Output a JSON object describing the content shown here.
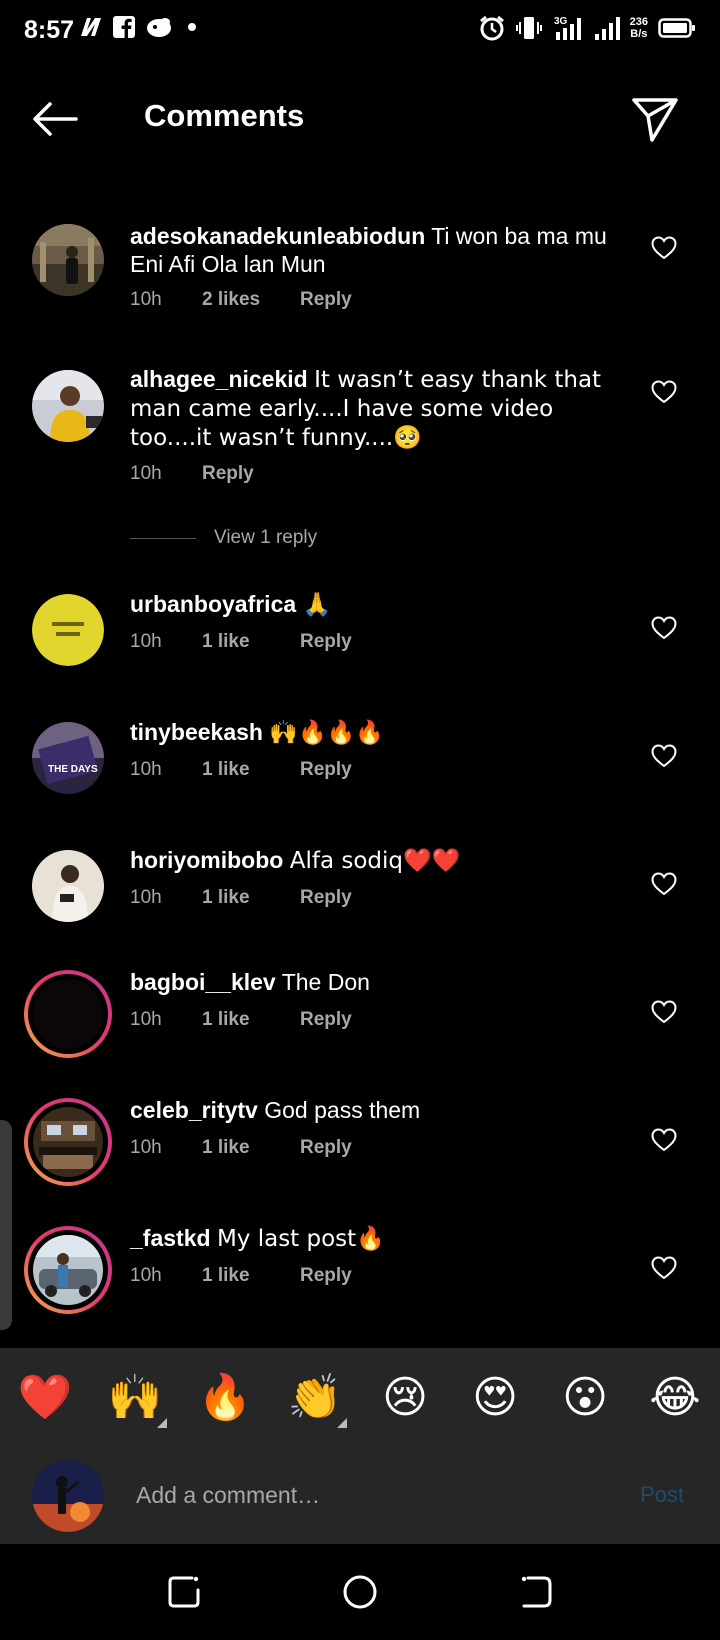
{
  "status_bar": {
    "time": "8:57",
    "net_speed_value": "236",
    "net_speed_unit": "B/s",
    "network_label": "3G"
  },
  "header": {
    "title": "Comments"
  },
  "comments": [
    {
      "username": "adesokanadekunleabiodun",
      "text": "Ti won ba ma mu Eni Afi Ola lan Mun",
      "time": "10h",
      "likes": "2 likes",
      "reply": "Reply"
    },
    {
      "username": "alhagee_nicekid",
      "text": "It wasn’t easy thank that man came early....I have some video too....it wasn’t funny....🥺",
      "time": "10h",
      "reply": "Reply"
    },
    {
      "username": "urbanboyafrica",
      "text": "🙏",
      "time": "10h",
      "likes": "1 like",
      "reply": "Reply"
    },
    {
      "username": "tinybeekash",
      "text": "🙌🔥🔥🔥",
      "time": "10h",
      "likes": "1 like",
      "reply": "Reply"
    },
    {
      "username": "horiyomibobo",
      "text": "Alfa sodiq❤️❤️",
      "time": "10h",
      "likes": "1 like",
      "reply": "Reply"
    },
    {
      "username": "bagboi__klev",
      "text": "The Don",
      "time": "10h",
      "likes": "1 like",
      "reply": "Reply"
    },
    {
      "username": "celeb_ritytv",
      "text": "God pass them",
      "time": "10h",
      "likes": "1 like",
      "reply": "Reply"
    },
    {
      "username": "_fastkd",
      "text": "My last post🔥",
      "time": "10h",
      "likes": "1 like",
      "reply": "Reply"
    }
  ],
  "view_replies_label": "View 1 reply",
  "avatar_texts": {
    "tinybeekash": "THE DAYS"
  },
  "quick_emojis": [
    "❤️",
    "🙌",
    "🔥",
    "👏",
    "😢",
    "😍",
    "😮",
    "😂"
  ],
  "composer": {
    "placeholder": "Add a comment…",
    "post_label": "Post"
  },
  "colors": {
    "background": "#000000",
    "panel": "#262626",
    "secondary_text": "#a8a8a8",
    "post_disabled": "#1d4d6f",
    "story_ring_start": "#f7b040",
    "story_ring_end": "#c53493"
  }
}
